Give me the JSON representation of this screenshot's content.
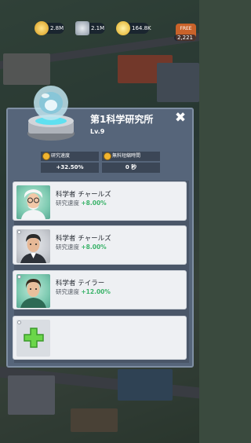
{
  "topbar": {
    "resources": [
      {
        "name": "gold",
        "value": "2.8M"
      },
      {
        "name": "steel",
        "value": "2.1M"
      },
      {
        "name": "coin",
        "value": "164.8K"
      }
    ],
    "right_button": "FREE",
    "right_count": "2,221"
  },
  "modal": {
    "title": "第1科学研究所",
    "level": "Lv.9",
    "stats": [
      {
        "label": "研究速度",
        "value": "+32.50%"
      },
      {
        "label": "無料短縮時間",
        "value": "0 秒"
      }
    ],
    "scientists": [
      {
        "name": "科学者 チャールズ",
        "speed_label": "研究速度",
        "speed_value": "+8.00%",
        "bg": "teal"
      },
      {
        "name": "科学者 チャールズ",
        "speed_label": "研究速度",
        "speed_value": "+8.00%",
        "bg": "grey"
      },
      {
        "name": "科学者 テイラー",
        "speed_label": "研究速度",
        "speed_value": "+12.00%",
        "bg": "teal"
      }
    ]
  },
  "colors": {
    "accent_green": "#3bb36a",
    "panel": "#56657a",
    "card": "#eef0f3"
  }
}
